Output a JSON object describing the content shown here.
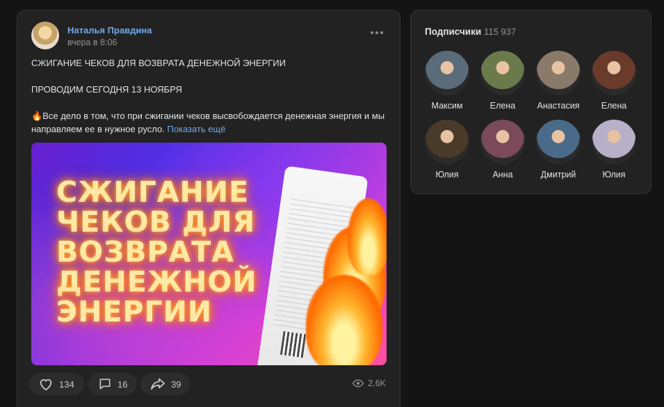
{
  "post": {
    "author": "Наталья Правдина",
    "time": "вчера в 8:06",
    "line1": "СЖИГАНИЕ ЧЕКОВ ДЛЯ ВОЗВРАТА ДЕНЕЖНОЙ ЭНЕРГИИ",
    "line2": "ПРОВОДИМ СЕГОДНЯ 13 НОЯБРЯ",
    "emoji": "🔥",
    "body": "Все дело в том, что при сжигании чеков высвобождается денежная энергия и мы направляем ее в нужное русло.",
    "show_more": "Показать ещё",
    "image_text": "СЖИГАНИЕ\nЧЕКОВ ДЛЯ\nВОЗВРАТА\nДЕНЕЖНОЙ\nЭНЕРГИИ",
    "likes": "134",
    "comments": "16",
    "shares": "39",
    "views": "2.6K"
  },
  "subscribers": {
    "title": "Подписчики",
    "count": "115 937",
    "items": [
      {
        "name": "Максим",
        "color": "#5a6b7a"
      },
      {
        "name": "Елена",
        "color": "#6a7a4a"
      },
      {
        "name": "Анастасия",
        "color": "#8a7a6a"
      },
      {
        "name": "Елена",
        "color": "#6a3a2a"
      },
      {
        "name": "Юлия",
        "color": "#4a3a2a"
      },
      {
        "name": "Анна",
        "color": "#7a4a5a"
      },
      {
        "name": "Дмитрий",
        "color": "#4a6a8a"
      },
      {
        "name": "Юлия",
        "color": "#b8b0c8"
      }
    ]
  }
}
